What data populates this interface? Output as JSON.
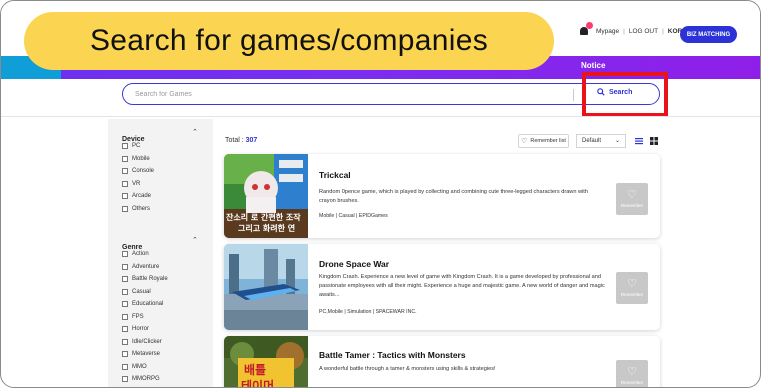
{
  "callout": {
    "text": "Search for games/companies"
  },
  "header": {
    "mypage": "Mypage",
    "logout": "LOG OUT",
    "lang": "KOR",
    "biz_matching": "BIZ MATCHING",
    "notice": "Notice"
  },
  "search": {
    "placeholder": "Search for Games",
    "button": "Search"
  },
  "sidebar": {
    "device": {
      "title": "Device",
      "items": [
        "PC",
        "Mobile",
        "Console",
        "VR",
        "Arcade",
        "Others"
      ]
    },
    "genre": {
      "title": "Genre",
      "items": [
        "Action",
        "Adventure",
        "Battle Royale",
        "Casual",
        "Educational",
        "FPS",
        "Horror",
        "Idle/Clicker",
        "Metaverse",
        "MMO",
        "MMORPG",
        "MOBA"
      ]
    }
  },
  "list": {
    "total_label": "Total : ",
    "total_count": "307",
    "remember_list": "Remember list",
    "sort": "Default",
    "remember_label": "Remember"
  },
  "games": [
    {
      "title": "Trickcal",
      "desc": "Random 0pence game, which is played by collecting and combining cute three-legged characters drawn with crayon brushes.",
      "tags": "Mobile | Casual | EPIDGames",
      "thumb_text": "잔소리 로 간편한 조작 그리고 화려한 연"
    },
    {
      "title": "Drone Space War",
      "desc": "Kingdom Crash. Experience a new level of game with Kingdom Crash. It is a game developed by professional and passionate employees with all their might. Experience a huge and majestic game. A new world of danger and magic awaits...",
      "tags": "PC,Mobile | Simulation | SPACEWAR INC."
    },
    {
      "title": "Battle Tamer : Tactics with Monsters",
      "desc": "A wonderful battle through a tamer & monsters using skills & strategies!",
      "tags": "",
      "thumb_text": "배틀 테이머"
    }
  ],
  "colors": {
    "brand": "#2b33d6",
    "callout": "#fbd451",
    "highlight": "#e8131b",
    "nav_gradient_start": "#6b2ff0",
    "nav_gradient_end": "#8f1fe8"
  }
}
